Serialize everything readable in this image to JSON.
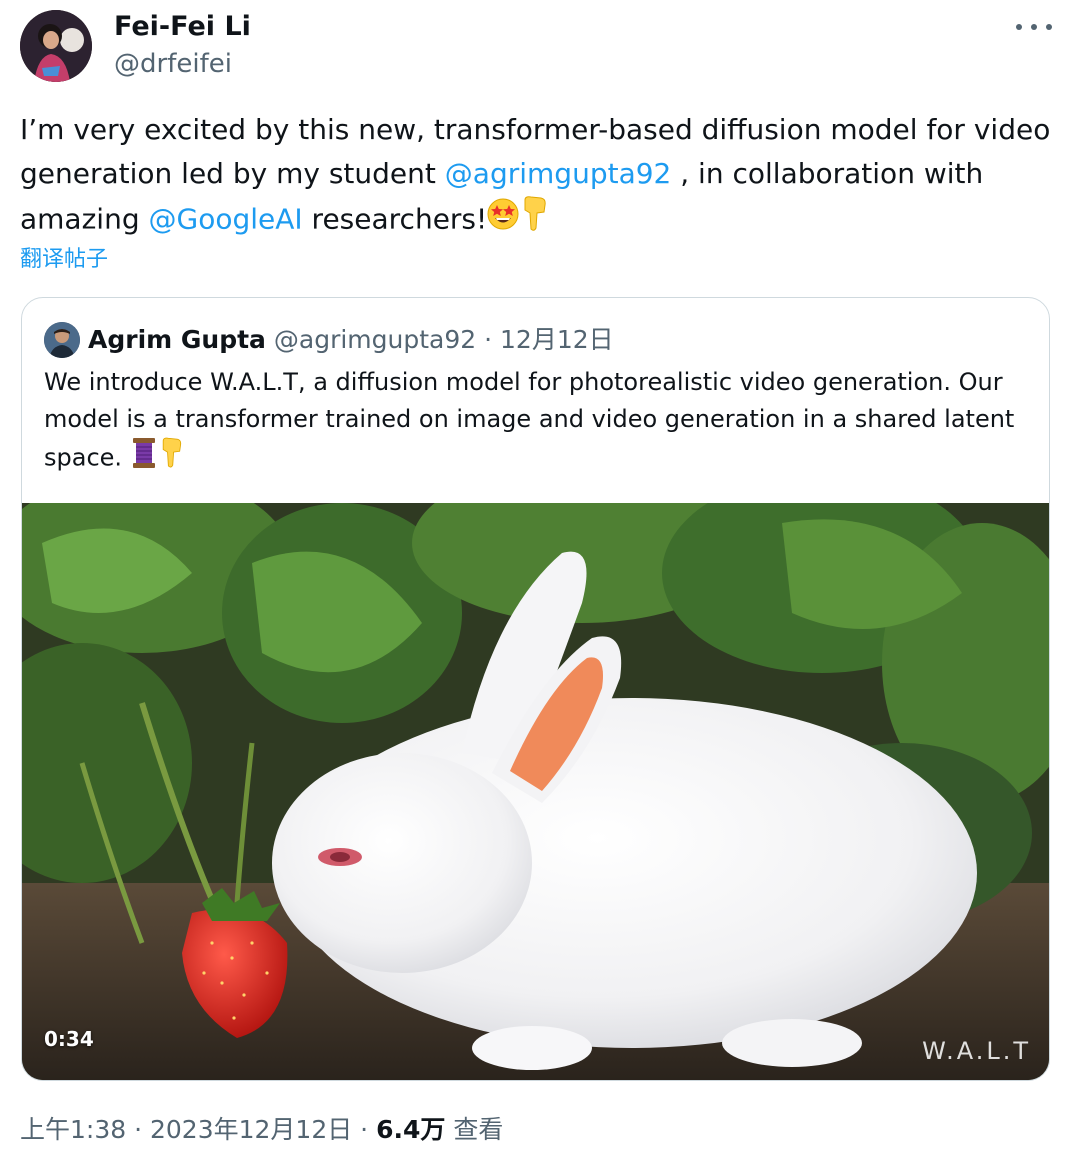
{
  "tweet": {
    "author_name": "Fei-Fei Li",
    "author_handle": "@drfeifei",
    "text_part1": "I’m very excited by this new, transformer-based diffusion model for video generation led by my student ",
    "mention1": "@agrimgupta92",
    "text_part2": " , in collaboration with amazing ",
    "mention2": "@GoogleAI",
    "text_part3": " researchers!",
    "emojis": [
      "star-struck-emoji",
      "pointing-down-emoji"
    ],
    "translate_label": "翻译帖子"
  },
  "quote": {
    "author_name": "Agrim Gupta",
    "author_handle": "@agrimgupta92",
    "separator": " · ",
    "date": "12月12日",
    "text": "We introduce W.A.L.T, a diffusion model for photorealistic video generation. Our model is a transformer trained on image and video generation in a shared latent space. ",
    "emojis": [
      "thread-spool-emoji",
      "pointing-down-emoji"
    ],
    "media": {
      "duration": "0:34",
      "watermark": "W.A.L.T"
    }
  },
  "footer": {
    "time": "上午1:38",
    "separator1": " · ",
    "date": "2023年12月12日",
    "separator2": " · ",
    "views_count": "6.4万",
    "views_label": " 查看"
  },
  "colors": {
    "link": "#1d9bf0",
    "secondary_text": "#536471",
    "border": "#cfd9de"
  }
}
